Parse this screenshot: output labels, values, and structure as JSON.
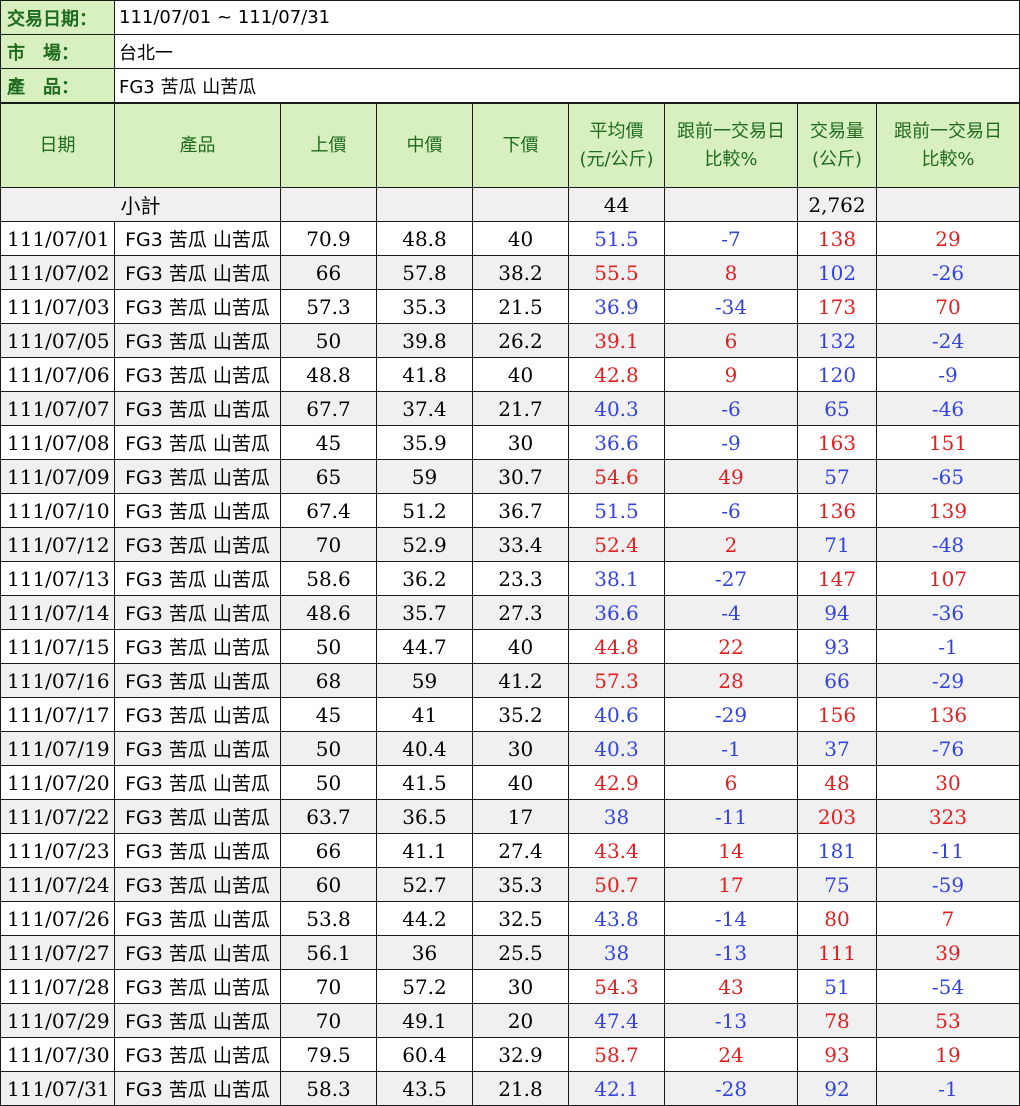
{
  "info": {
    "date_label": "交易日期：",
    "date_value": "111/07/01 ~ 111/07/31",
    "market_label": "市　場：",
    "market_value": "台北一",
    "product_label": "產　品：",
    "product_value": "FG3 苦瓜 山苦瓜"
  },
  "headers": {
    "date": "日期",
    "product": "產品",
    "upper": "上價",
    "middle": "中價",
    "lower": "下價",
    "avg_1": "平均價",
    "avg_2": "(元/公斤)",
    "avg_cmp_1": "跟前一交易日",
    "avg_cmp_2": "比較%",
    "vol_1": "交易量",
    "vol_2": "(公斤)",
    "vol_cmp_1": "跟前一交易日",
    "vol_cmp_2": "比較%"
  },
  "subtotal": {
    "label": "小計",
    "avg": "44",
    "volume": "2,762"
  },
  "colors": {
    "header_bg": "#d8f0c0",
    "header_text": "#1e6b1e",
    "up": "#e02020",
    "down": "#3344dd",
    "stripe": "#f0f0f0"
  },
  "rows": [
    {
      "date": "111/07/01",
      "product": "FG3 苦瓜 山苦瓜",
      "upper": "70.9",
      "middle": "48.8",
      "lower": "40",
      "avg": "51.5",
      "avg_cmp": "-7",
      "volume": "138",
      "vol_cmp": "29",
      "avg_c": "blue",
      "avgcmp_c": "blue",
      "vol_c": "red",
      "volcmp_c": "red"
    },
    {
      "date": "111/07/02",
      "product": "FG3 苦瓜 山苦瓜",
      "upper": "66",
      "middle": "57.8",
      "lower": "38.2",
      "avg": "55.5",
      "avg_cmp": "8",
      "volume": "102",
      "vol_cmp": "-26",
      "avg_c": "red",
      "avgcmp_c": "red",
      "vol_c": "blue",
      "volcmp_c": "blue"
    },
    {
      "date": "111/07/03",
      "product": "FG3 苦瓜 山苦瓜",
      "upper": "57.3",
      "middle": "35.3",
      "lower": "21.5",
      "avg": "36.9",
      "avg_cmp": "-34",
      "volume": "173",
      "vol_cmp": "70",
      "avg_c": "blue",
      "avgcmp_c": "blue",
      "vol_c": "red",
      "volcmp_c": "red"
    },
    {
      "date": "111/07/05",
      "product": "FG3 苦瓜 山苦瓜",
      "upper": "50",
      "middle": "39.8",
      "lower": "26.2",
      "avg": "39.1",
      "avg_cmp": "6",
      "volume": "132",
      "vol_cmp": "-24",
      "avg_c": "red",
      "avgcmp_c": "red",
      "vol_c": "blue",
      "volcmp_c": "blue"
    },
    {
      "date": "111/07/06",
      "product": "FG3 苦瓜 山苦瓜",
      "upper": "48.8",
      "middle": "41.8",
      "lower": "40",
      "avg": "42.8",
      "avg_cmp": "9",
      "volume": "120",
      "vol_cmp": "-9",
      "avg_c": "red",
      "avgcmp_c": "red",
      "vol_c": "blue",
      "volcmp_c": "blue"
    },
    {
      "date": "111/07/07",
      "product": "FG3 苦瓜 山苦瓜",
      "upper": "67.7",
      "middle": "37.4",
      "lower": "21.7",
      "avg": "40.3",
      "avg_cmp": "-6",
      "volume": "65",
      "vol_cmp": "-46",
      "avg_c": "blue",
      "avgcmp_c": "blue",
      "vol_c": "blue",
      "volcmp_c": "blue"
    },
    {
      "date": "111/07/08",
      "product": "FG3 苦瓜 山苦瓜",
      "upper": "45",
      "middle": "35.9",
      "lower": "30",
      "avg": "36.6",
      "avg_cmp": "-9",
      "volume": "163",
      "vol_cmp": "151",
      "avg_c": "blue",
      "avgcmp_c": "blue",
      "vol_c": "red",
      "volcmp_c": "red"
    },
    {
      "date": "111/07/09",
      "product": "FG3 苦瓜 山苦瓜",
      "upper": "65",
      "middle": "59",
      "lower": "30.7",
      "avg": "54.6",
      "avg_cmp": "49",
      "volume": "57",
      "vol_cmp": "-65",
      "avg_c": "red",
      "avgcmp_c": "red",
      "vol_c": "blue",
      "volcmp_c": "blue"
    },
    {
      "date": "111/07/10",
      "product": "FG3 苦瓜 山苦瓜",
      "upper": "67.4",
      "middle": "51.2",
      "lower": "36.7",
      "avg": "51.5",
      "avg_cmp": "-6",
      "volume": "136",
      "vol_cmp": "139",
      "avg_c": "blue",
      "avgcmp_c": "blue",
      "vol_c": "red",
      "volcmp_c": "red"
    },
    {
      "date": "111/07/12",
      "product": "FG3 苦瓜 山苦瓜",
      "upper": "70",
      "middle": "52.9",
      "lower": "33.4",
      "avg": "52.4",
      "avg_cmp": "2",
      "volume": "71",
      "vol_cmp": "-48",
      "avg_c": "red",
      "avgcmp_c": "red",
      "vol_c": "blue",
      "volcmp_c": "blue"
    },
    {
      "date": "111/07/13",
      "product": "FG3 苦瓜 山苦瓜",
      "upper": "58.6",
      "middle": "36.2",
      "lower": "23.3",
      "avg": "38.1",
      "avg_cmp": "-27",
      "volume": "147",
      "vol_cmp": "107",
      "avg_c": "blue",
      "avgcmp_c": "blue",
      "vol_c": "red",
      "volcmp_c": "red"
    },
    {
      "date": "111/07/14",
      "product": "FG3 苦瓜 山苦瓜",
      "upper": "48.6",
      "middle": "35.7",
      "lower": "27.3",
      "avg": "36.6",
      "avg_cmp": "-4",
      "volume": "94",
      "vol_cmp": "-36",
      "avg_c": "blue",
      "avgcmp_c": "blue",
      "vol_c": "blue",
      "volcmp_c": "blue"
    },
    {
      "date": "111/07/15",
      "product": "FG3 苦瓜 山苦瓜",
      "upper": "50",
      "middle": "44.7",
      "lower": "40",
      "avg": "44.8",
      "avg_cmp": "22",
      "volume": "93",
      "vol_cmp": "-1",
      "avg_c": "red",
      "avgcmp_c": "red",
      "vol_c": "blue",
      "volcmp_c": "blue"
    },
    {
      "date": "111/07/16",
      "product": "FG3 苦瓜 山苦瓜",
      "upper": "68",
      "middle": "59",
      "lower": "41.2",
      "avg": "57.3",
      "avg_cmp": "28",
      "volume": "66",
      "vol_cmp": "-29",
      "avg_c": "red",
      "avgcmp_c": "red",
      "vol_c": "blue",
      "volcmp_c": "blue"
    },
    {
      "date": "111/07/17",
      "product": "FG3 苦瓜 山苦瓜",
      "upper": "45",
      "middle": "41",
      "lower": "35.2",
      "avg": "40.6",
      "avg_cmp": "-29",
      "volume": "156",
      "vol_cmp": "136",
      "avg_c": "blue",
      "avgcmp_c": "blue",
      "vol_c": "red",
      "volcmp_c": "red"
    },
    {
      "date": "111/07/19",
      "product": "FG3 苦瓜 山苦瓜",
      "upper": "50",
      "middle": "40.4",
      "lower": "30",
      "avg": "40.3",
      "avg_cmp": "-1",
      "volume": "37",
      "vol_cmp": "-76",
      "avg_c": "blue",
      "avgcmp_c": "blue",
      "vol_c": "blue",
      "volcmp_c": "blue"
    },
    {
      "date": "111/07/20",
      "product": "FG3 苦瓜 山苦瓜",
      "upper": "50",
      "middle": "41.5",
      "lower": "40",
      "avg": "42.9",
      "avg_cmp": "6",
      "volume": "48",
      "vol_cmp": "30",
      "avg_c": "red",
      "avgcmp_c": "red",
      "vol_c": "red",
      "volcmp_c": "red"
    },
    {
      "date": "111/07/22",
      "product": "FG3 苦瓜 山苦瓜",
      "upper": "63.7",
      "middle": "36.5",
      "lower": "17",
      "avg": "38",
      "avg_cmp": "-11",
      "volume": "203",
      "vol_cmp": "323",
      "avg_c": "blue",
      "avgcmp_c": "blue",
      "vol_c": "red",
      "volcmp_c": "red"
    },
    {
      "date": "111/07/23",
      "product": "FG3 苦瓜 山苦瓜",
      "upper": "66",
      "middle": "41.1",
      "lower": "27.4",
      "avg": "43.4",
      "avg_cmp": "14",
      "volume": "181",
      "vol_cmp": "-11",
      "avg_c": "red",
      "avgcmp_c": "red",
      "vol_c": "blue",
      "volcmp_c": "blue"
    },
    {
      "date": "111/07/24",
      "product": "FG3 苦瓜 山苦瓜",
      "upper": "60",
      "middle": "52.7",
      "lower": "35.3",
      "avg": "50.7",
      "avg_cmp": "17",
      "volume": "75",
      "vol_cmp": "-59",
      "avg_c": "red",
      "avgcmp_c": "red",
      "vol_c": "blue",
      "volcmp_c": "blue"
    },
    {
      "date": "111/07/26",
      "product": "FG3 苦瓜 山苦瓜",
      "upper": "53.8",
      "middle": "44.2",
      "lower": "32.5",
      "avg": "43.8",
      "avg_cmp": "-14",
      "volume": "80",
      "vol_cmp": "7",
      "avg_c": "blue",
      "avgcmp_c": "blue",
      "vol_c": "red",
      "volcmp_c": "red"
    },
    {
      "date": "111/07/27",
      "product": "FG3 苦瓜 山苦瓜",
      "upper": "56.1",
      "middle": "36",
      "lower": "25.5",
      "avg": "38",
      "avg_cmp": "-13",
      "volume": "111",
      "vol_cmp": "39",
      "avg_c": "blue",
      "avgcmp_c": "blue",
      "vol_c": "red",
      "volcmp_c": "red"
    },
    {
      "date": "111/07/28",
      "product": "FG3 苦瓜 山苦瓜",
      "upper": "70",
      "middle": "57.2",
      "lower": "30",
      "avg": "54.3",
      "avg_cmp": "43",
      "volume": "51",
      "vol_cmp": "-54",
      "avg_c": "red",
      "avgcmp_c": "red",
      "vol_c": "blue",
      "volcmp_c": "blue"
    },
    {
      "date": "111/07/29",
      "product": "FG3 苦瓜 山苦瓜",
      "upper": "70",
      "middle": "49.1",
      "lower": "20",
      "avg": "47.4",
      "avg_cmp": "-13",
      "volume": "78",
      "vol_cmp": "53",
      "avg_c": "blue",
      "avgcmp_c": "blue",
      "vol_c": "red",
      "volcmp_c": "red"
    },
    {
      "date": "111/07/30",
      "product": "FG3 苦瓜 山苦瓜",
      "upper": "79.5",
      "middle": "60.4",
      "lower": "32.9",
      "avg": "58.7",
      "avg_cmp": "24",
      "volume": "93",
      "vol_cmp": "19",
      "avg_c": "red",
      "avgcmp_c": "red",
      "vol_c": "red",
      "volcmp_c": "red"
    },
    {
      "date": "111/07/31",
      "product": "FG3 苦瓜 山苦瓜",
      "upper": "58.3",
      "middle": "43.5",
      "lower": "21.8",
      "avg": "42.1",
      "avg_cmp": "-28",
      "volume": "92",
      "vol_cmp": "-1",
      "avg_c": "blue",
      "avgcmp_c": "blue",
      "vol_c": "blue",
      "volcmp_c": "blue"
    }
  ]
}
